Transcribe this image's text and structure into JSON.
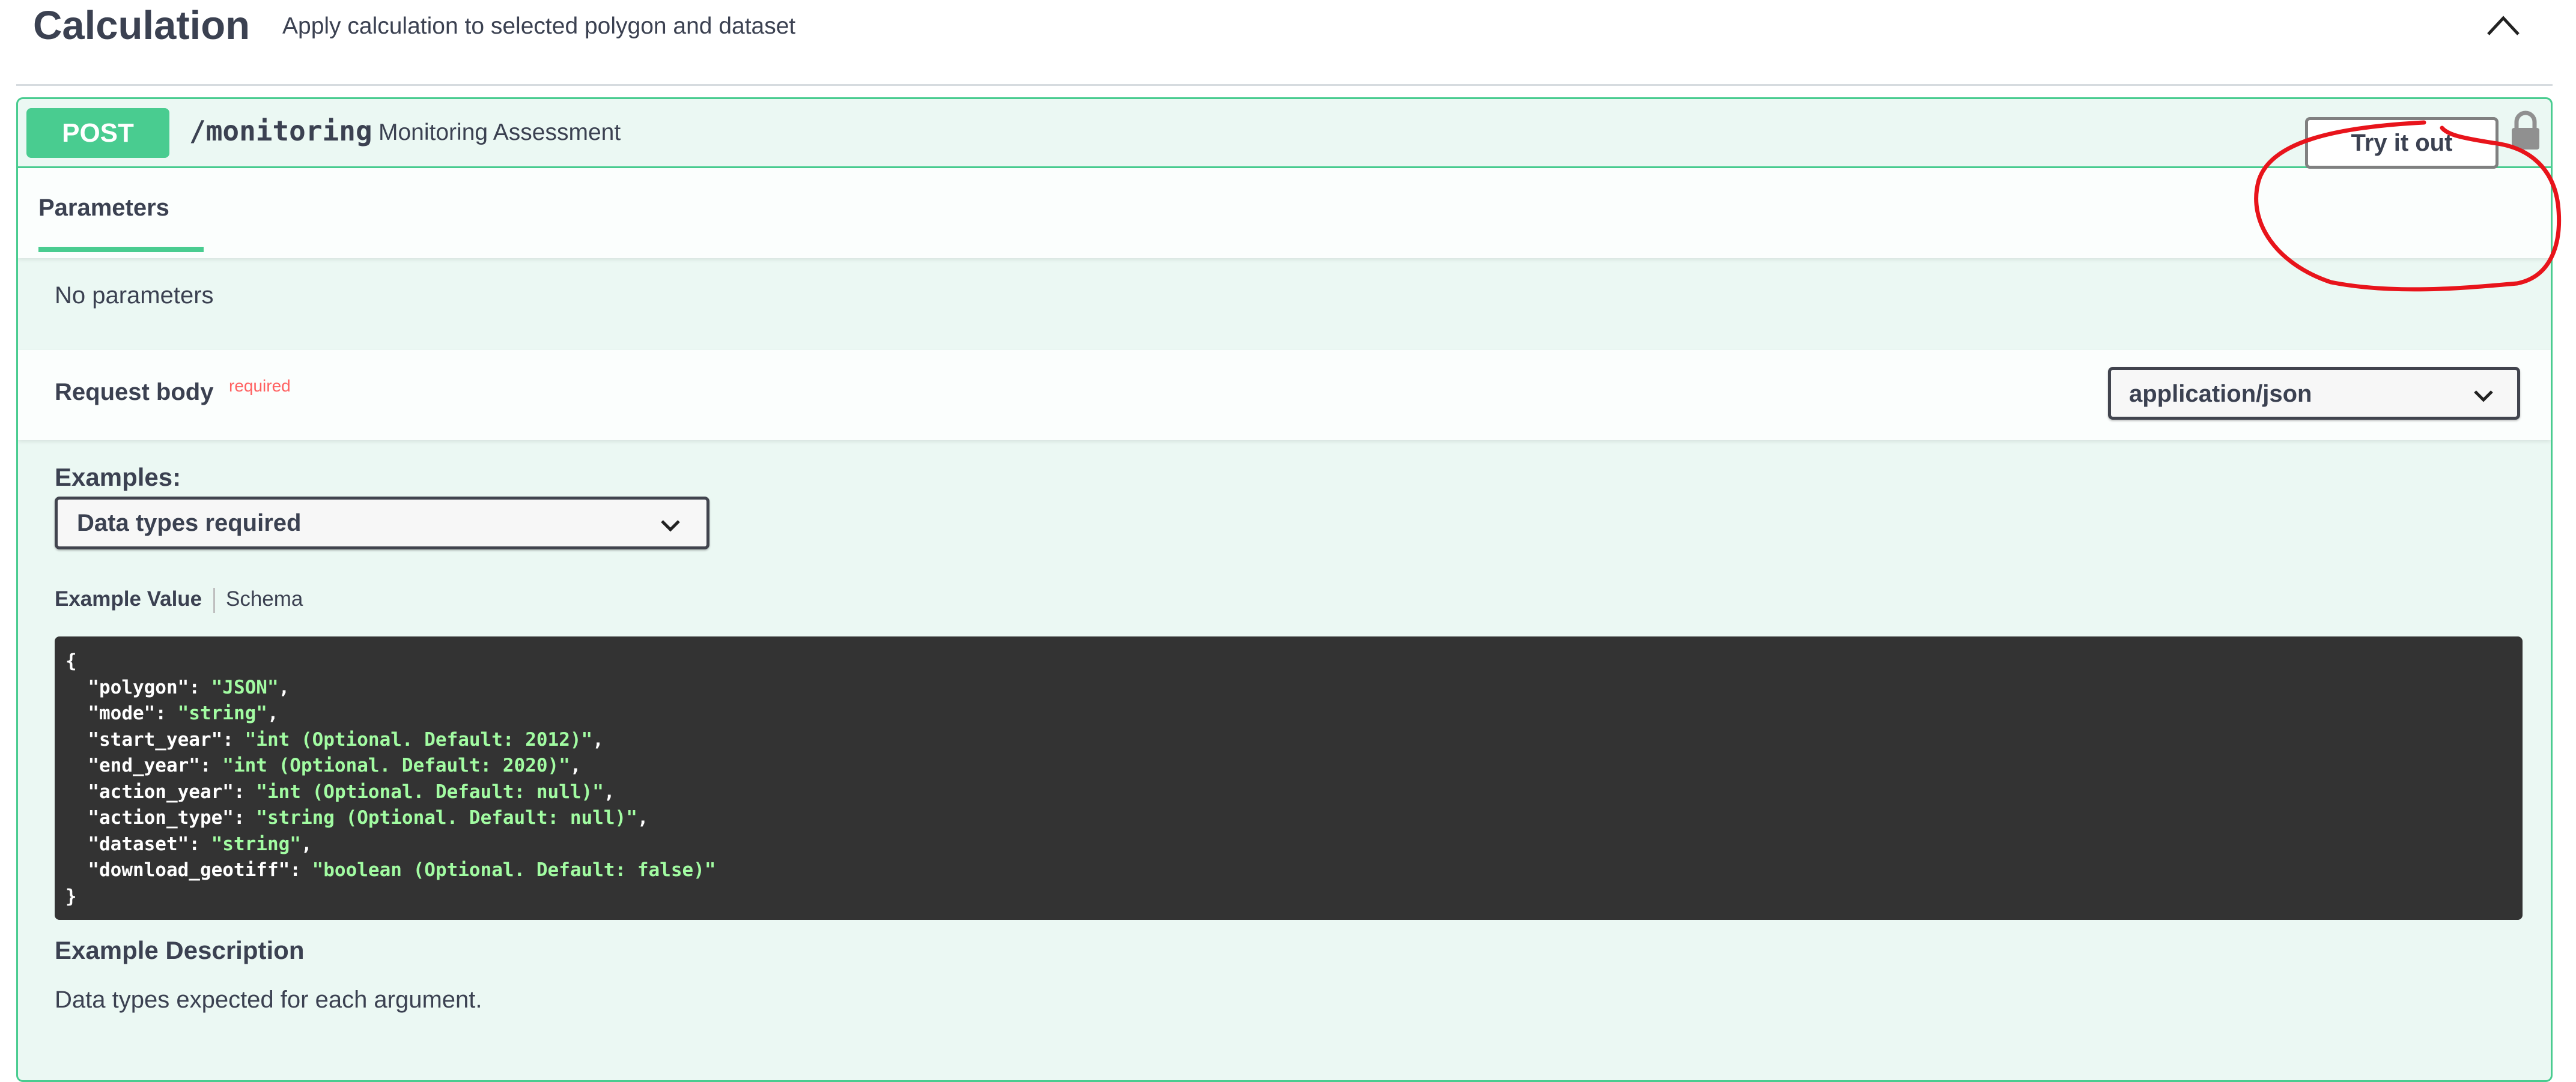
{
  "tag": {
    "title": "Calculation",
    "description": "Apply calculation to selected polygon and dataset",
    "collapse_icon": "chevron-up-icon"
  },
  "operation": {
    "method": "POST",
    "path": "/monitoring",
    "summary": "Monitoring Assessment",
    "collapse_icon": "chevron-up-icon",
    "lock_icon": "lock-icon",
    "method_color": "#49cc90"
  },
  "parameters": {
    "tab_label": "Parameters",
    "try_it_out_label": "Try it out",
    "empty_text": "No parameters"
  },
  "request_body": {
    "title": "Request body",
    "required_label": "required",
    "content_type": "application/json",
    "examples_label": "Examples:",
    "examples_selected": "Data types required",
    "tab_example_value": "Example Value",
    "tab_schema": "Schema",
    "code": {
      "open": "{",
      "close": "}",
      "lines": [
        {
          "key": "\"polygon\"",
          "value": "\"JSON\"",
          "comma": ","
        },
        {
          "key": "\"mode\"",
          "value": "\"string\"",
          "comma": ","
        },
        {
          "key": "\"start_year\"",
          "value": "\"int (Optional. Default: 2012)\"",
          "comma": ","
        },
        {
          "key": "\"end_year\"",
          "value": "\"int (Optional. Default: 2020)\"",
          "comma": ","
        },
        {
          "key": "\"action_year\"",
          "value": "\"int (Optional. Default: null)\"",
          "comma": ","
        },
        {
          "key": "\"action_type\"",
          "value": "\"string (Optional. Default: null)\"",
          "comma": ","
        },
        {
          "key": "\"dataset\"",
          "value": "\"string\"",
          "comma": ","
        },
        {
          "key": "\"download_geotiff\"",
          "value": "\"boolean (Optional. Default: false)\"",
          "comma": ""
        }
      ]
    },
    "example_description_title": "Example Description",
    "example_description_text": "Data types expected for each argument."
  },
  "colors": {
    "annotation": "#e8141b",
    "code_background": "#333333",
    "code_string": "#a2fca2",
    "required": "#ff6060"
  }
}
